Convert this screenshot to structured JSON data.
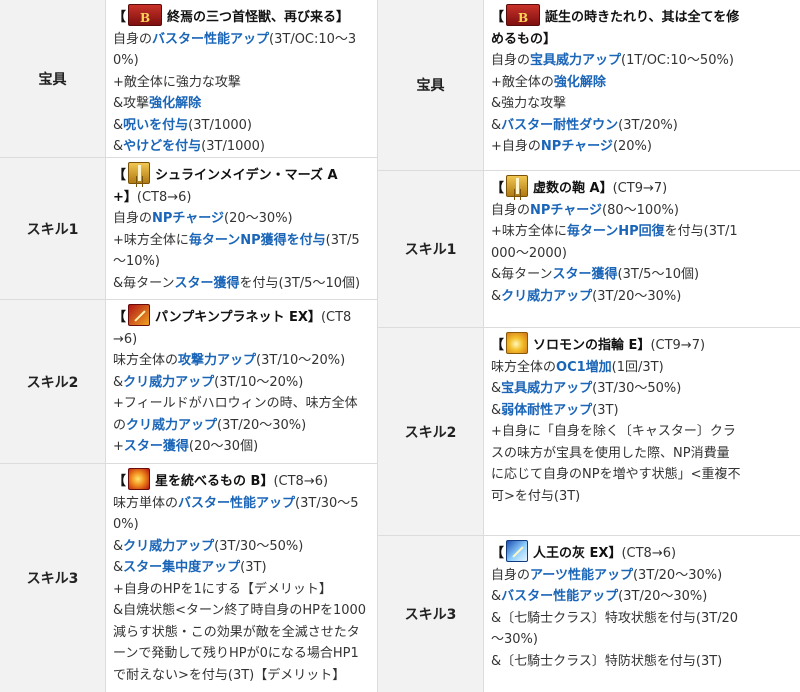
{
  "left": {
    "noble": {
      "label": "宝具",
      "open": "【",
      "title": "終焉の三つ首怪獣、再び来る】",
      "l1a": "自身の",
      "l1b": "バスター性能アップ",
      "l1c": "(3T/OC:10～3",
      "l2": "0%)",
      "l3": "+敵全体に強力な攻撃",
      "l4a": "&攻撃",
      "l4b": "強化解除",
      "l5a": "&",
      "l5b": "呪いを付与",
      "l5c": "(3T/1000)",
      "l6a": "&",
      "l6b": "やけどを付与",
      "l6c": "(3T/1000)"
    },
    "s1": {
      "label": "スキル1",
      "open": "【",
      "title": "シュラインメイデン・マーズ A",
      "l1a": "+】",
      "l1b": "(CT8→6)",
      "l2a": "自身の",
      "l2b": "NPチャージ",
      "l2c": "(20～30%)",
      "l3a": "+味方全体に",
      "l3b": "毎ターンNP獲得を付与",
      "l3c": "(3T/5",
      "l4": "～10%)",
      "l5a": "&毎ターン",
      "l5b": "スター獲得",
      "l5c": "を付与(3T/5～10個)"
    },
    "s2": {
      "label": "スキル2",
      "open": "【",
      "title": "パンプキンプラネット EX】",
      "titleTail": "(CT8",
      "l1": "→6)",
      "l2a": "味方全体の",
      "l2b": "攻撃力アップ",
      "l2c": "(3T/10～20%)",
      "l3a": "&",
      "l3b": "クリ威力アップ",
      "l3c": "(3T/10～20%)",
      "l4": "+フィールドがハロウィンの時、味方全体",
      "l5a": "の",
      "l5b": "クリ威力アップ",
      "l5c": "(3T/20～30%)",
      "l6a": "+",
      "l6b": "スター獲得",
      "l6c": "(20～30個)"
    },
    "s3": {
      "label": "スキル3",
      "open": "【",
      "title": "星を統べるもの B】",
      "titleTail": "(CT8→6)",
      "l1a": "味方単体の",
      "l1b": "バスター性能アップ",
      "l1c": "(3T/30～5",
      "l2": "0%)",
      "l3a": "&",
      "l3b": "クリ威力アップ",
      "l3c": "(3T/30～50%)",
      "l4a": "&",
      "l4b": "スター集中度アップ",
      "l4c": "(3T)",
      "l5": "+自身のHPを1にする【デメリット】",
      "l6": "&自焼状態<ターン終了時自身のHPを1000",
      "l7": "減らす状態・この効果が敵を全滅させたタ",
      "l8": "ーンで発動して残りHPが0になる場合HP1",
      "l9": "で耐えない>を付与(3T)【デメリット】"
    }
  },
  "right": {
    "noble": {
      "label": "宝具",
      "open": "【",
      "title": "誕生の時きたれり、其は全てを修",
      "l1": "めるもの】",
      "l2a": "自身の",
      "l2b": "宝具威力アップ",
      "l2c": "(1T/OC:10～50%)",
      "l3a": "+敵全体の",
      "l3b": "強化解除",
      "l4": "&強力な攻撃",
      "l5a": "&",
      "l5b": "バスター耐性ダウン",
      "l5c": "(3T/20%)",
      "l6a": "+自身の",
      "l6b": "NPチャージ",
      "l6c": "(20%)"
    },
    "s1": {
      "label": "スキル1",
      "open": "【",
      "title": "虚数の鞄 A】",
      "titleTail": "(CT9→7)",
      "l1a": "自身の",
      "l1b": "NPチャージ",
      "l1c": "(80～100%)",
      "l2a": "+味方全体に",
      "l2b": "毎ターンHP回復",
      "l2c": "を付与(3T/1",
      "l3": "000～2000)",
      "l4a": "&毎ターン",
      "l4b": "スター獲得",
      "l4c": "(3T/5～10個)",
      "l5a": "&",
      "l5b": "クリ威力アップ",
      "l5c": "(3T/20～30%)"
    },
    "s2": {
      "label": "スキル2",
      "open": "【",
      "title": "ソロモンの指輪 E】",
      "titleTail": "(CT9→7)",
      "l1a": "味方全体の",
      "l1b": "OC1増加",
      "l1c": "(1回/3T)",
      "l2a": "&",
      "l2b": "宝具威力アップ",
      "l2c": "(3T/30～50%)",
      "l3a": "&",
      "l3b": "弱体耐性アップ",
      "l3c": "(3T)",
      "l4": "+自身に「自身を除く〔キャスター〕クラ",
      "l5": "スの味方が宝具を使用した際、NP消費量",
      "l6": "に応じて自身のNPを増やす状態」<重複不",
      "l7": "可>を付与(3T)"
    },
    "s3": {
      "label": "スキル3",
      "open": "【",
      "title": "人王の灰 EX】",
      "titleTail": "(CT8→6)",
      "l1a": "自身の",
      "l1b": "アーツ性能アップ",
      "l1c": "(3T/20～30%)",
      "l2a": "&",
      "l2b": "バスター性能アップ",
      "l2c": "(3T/20～30%)",
      "l3": "&〔七騎士クラス〕特攻状態を付与(3T/20",
      "l4": "～30%)",
      "l5": "&〔七騎士クラス〕特防状態を付与(3T)"
    }
  },
  "colors": {
    "accent": "#1a65b8",
    "label_bg": "#f2f2f2",
    "border": "#dcdcdc"
  },
  "icons": {
    "left_noble": "buster-card-icon",
    "left_s1": "sword-icon",
    "left_s2": "pumpkin-sword-icon",
    "left_s3": "star-burst-icon",
    "right_noble": "buster-card-icon",
    "right_s1": "sword-icon",
    "right_s2": "np-gain-icon",
    "right_s3": "blue-sword-icon"
  }
}
